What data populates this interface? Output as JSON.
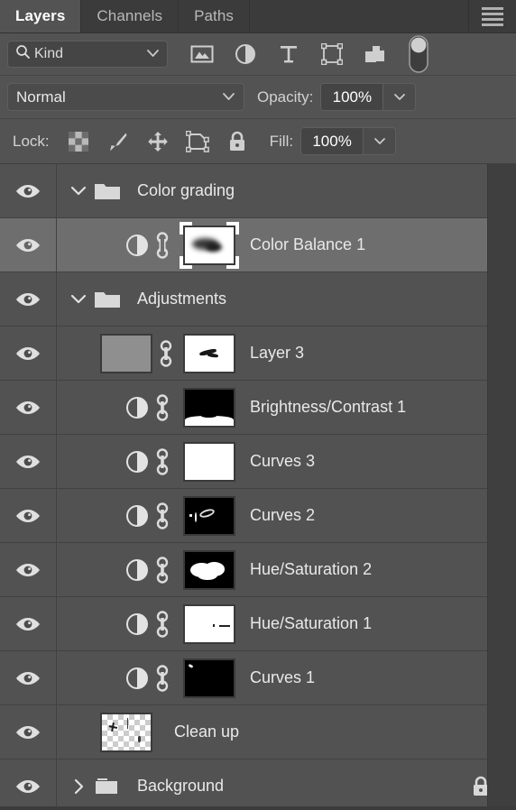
{
  "panel": {
    "tabs": [
      {
        "label": "Layers",
        "active": true
      },
      {
        "label": "Channels",
        "active": false
      },
      {
        "label": "Paths",
        "active": false
      }
    ],
    "menu_icon": "hamburger-menu-icon"
  },
  "filter": {
    "kind_label": "Kind",
    "search_icon": "magnifier-icon",
    "dropdown_icon": "chevron-down-icon",
    "type_filters": [
      {
        "name": "filter-pixel-layers-icon",
        "title": "Pixel layers"
      },
      {
        "name": "filter-adjustment-layers-icon",
        "title": "Adjustment layers"
      },
      {
        "name": "filter-type-layers-icon",
        "title": "Type layers"
      },
      {
        "name": "filter-shape-layers-icon",
        "title": "Shape layers"
      },
      {
        "name": "filter-smart-object-layers-icon",
        "title": "Smart objects"
      }
    ],
    "toggle_icon": "filter-enable-toggle"
  },
  "blend": {
    "mode": "Normal",
    "mode_dropdown_icon": "chevron-down-icon",
    "opacity_label": "Opacity:",
    "opacity_value": "100%",
    "opacity_spin_icon": "chevron-down-icon"
  },
  "lock": {
    "label": "Lock:",
    "fill_label": "Fill:",
    "fill_value": "100%",
    "fill_spin_icon": "chevron-down-icon",
    "icons": [
      {
        "name": "lock-transparent-pixels-icon"
      },
      {
        "name": "lock-image-pixels-icon"
      },
      {
        "name": "lock-position-icon"
      },
      {
        "name": "lock-artboard-nesting-icon"
      },
      {
        "name": "lock-all-icon"
      }
    ]
  },
  "layers": [
    {
      "name": "Color grading",
      "type": "group",
      "visible": true,
      "expanded": true,
      "selected": false,
      "indent": 0,
      "has_mask": false,
      "locked": false
    },
    {
      "name": "Color Balance 1",
      "type": "adjustment",
      "visible": true,
      "selected": true,
      "indent": 1,
      "has_mask": true,
      "mask_kind": "blob-soft",
      "linked": true,
      "locked": false
    },
    {
      "name": "Adjustments",
      "type": "group",
      "visible": true,
      "expanded": true,
      "selected": false,
      "indent": 0,
      "has_mask": false,
      "locked": false
    },
    {
      "name": "Layer 3",
      "type": "pixel",
      "visible": true,
      "selected": false,
      "indent": 1,
      "has_mask": true,
      "mask_kind": "white-small-mark",
      "linked": true,
      "locked": false
    },
    {
      "name": "Brightness/Contrast 1",
      "type": "adjustment",
      "visible": true,
      "selected": false,
      "indent": 1,
      "has_mask": true,
      "mask_kind": "black-bottom-white",
      "linked": true,
      "locked": false
    },
    {
      "name": "Curves 3",
      "type": "adjustment",
      "visible": true,
      "selected": false,
      "indent": 1,
      "has_mask": true,
      "mask_kind": "white",
      "linked": true,
      "locked": false
    },
    {
      "name": "Curves 2",
      "type": "adjustment",
      "visible": true,
      "selected": false,
      "indent": 1,
      "has_mask": true,
      "mask_kind": "black-small-marks",
      "linked": true,
      "locked": false
    },
    {
      "name": "Hue/Saturation 2",
      "type": "adjustment",
      "visible": true,
      "selected": false,
      "indent": 1,
      "has_mask": true,
      "mask_kind": "black-white-blob",
      "linked": true,
      "locked": false
    },
    {
      "name": "Hue/Saturation 1",
      "type": "adjustment",
      "visible": true,
      "selected": false,
      "indent": 1,
      "has_mask": true,
      "mask_kind": "white-tiny-marks",
      "linked": true,
      "locked": false
    },
    {
      "name": "Curves 1",
      "type": "adjustment",
      "visible": true,
      "selected": false,
      "indent": 1,
      "has_mask": true,
      "mask_kind": "black-corner-mark",
      "linked": true,
      "locked": false
    },
    {
      "name": "Clean up",
      "type": "pixel",
      "visible": true,
      "selected": false,
      "indent": 1,
      "has_mask": false,
      "thumb_kind": "transparent",
      "locked": false
    },
    {
      "name": "Background",
      "type": "group",
      "visible": true,
      "expanded": false,
      "selected": false,
      "indent": 0,
      "has_mask": false,
      "locked": true
    }
  ],
  "colors": {
    "panel_bg": "#535353",
    "row_bg": "#525252",
    "row_selected_bg": "#6e6e6e",
    "tabbar_bg": "#3b3b3b",
    "divider": "#414141",
    "text": "#e9e9e9",
    "icon": "#d0d0d0"
  },
  "icon_names": {
    "eye": "visibility-eye-icon",
    "chevron_down": "chevron-down-icon",
    "chevron_right": "chevron-right-icon",
    "folder": "folder-icon",
    "adjustment_disc": "adjustment-half-circle-icon",
    "link": "link-chain-icon",
    "lock_badge": "lock-icon"
  }
}
